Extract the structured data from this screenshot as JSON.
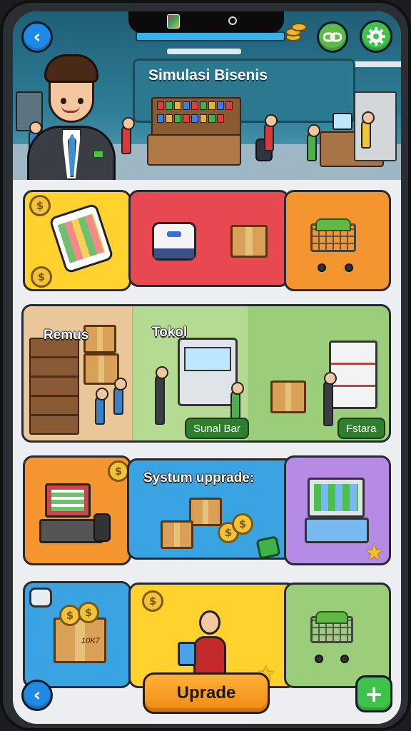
{
  "header": {
    "title": "Simulasi Bisenis",
    "back_icon": "chevron-left-icon",
    "link_icon": "link-icon",
    "settings_icon": "gear-icon",
    "coins_icon": "coin-stack-icon"
  },
  "tiles": {
    "row1": [
      "phone-payment-icon",
      "lunchbox-icon",
      "package-box-icon",
      "shopping-cart-icon"
    ],
    "row2": {
      "left_title": "Remus",
      "mid_title": "Tokol",
      "mid_tag": "Sunal Bar",
      "right_tag": "Fstara"
    },
    "row3": {
      "title": "Systum upprade:"
    },
    "row4": {
      "box_label": "10K7"
    }
  },
  "footer": {
    "upgrade_label": "Uprade",
    "plus_label": "+",
    "back_label": "‹"
  },
  "colors": {
    "yellow": "#ffd22e",
    "red": "#e8484f",
    "orange": "#f4952f",
    "green_panel": "#9ccd7a",
    "blue": "#3aa3e2",
    "purple": "#b58be6",
    "accent_green": "#3ec24a",
    "accent_blue": "#1f8ae5"
  }
}
